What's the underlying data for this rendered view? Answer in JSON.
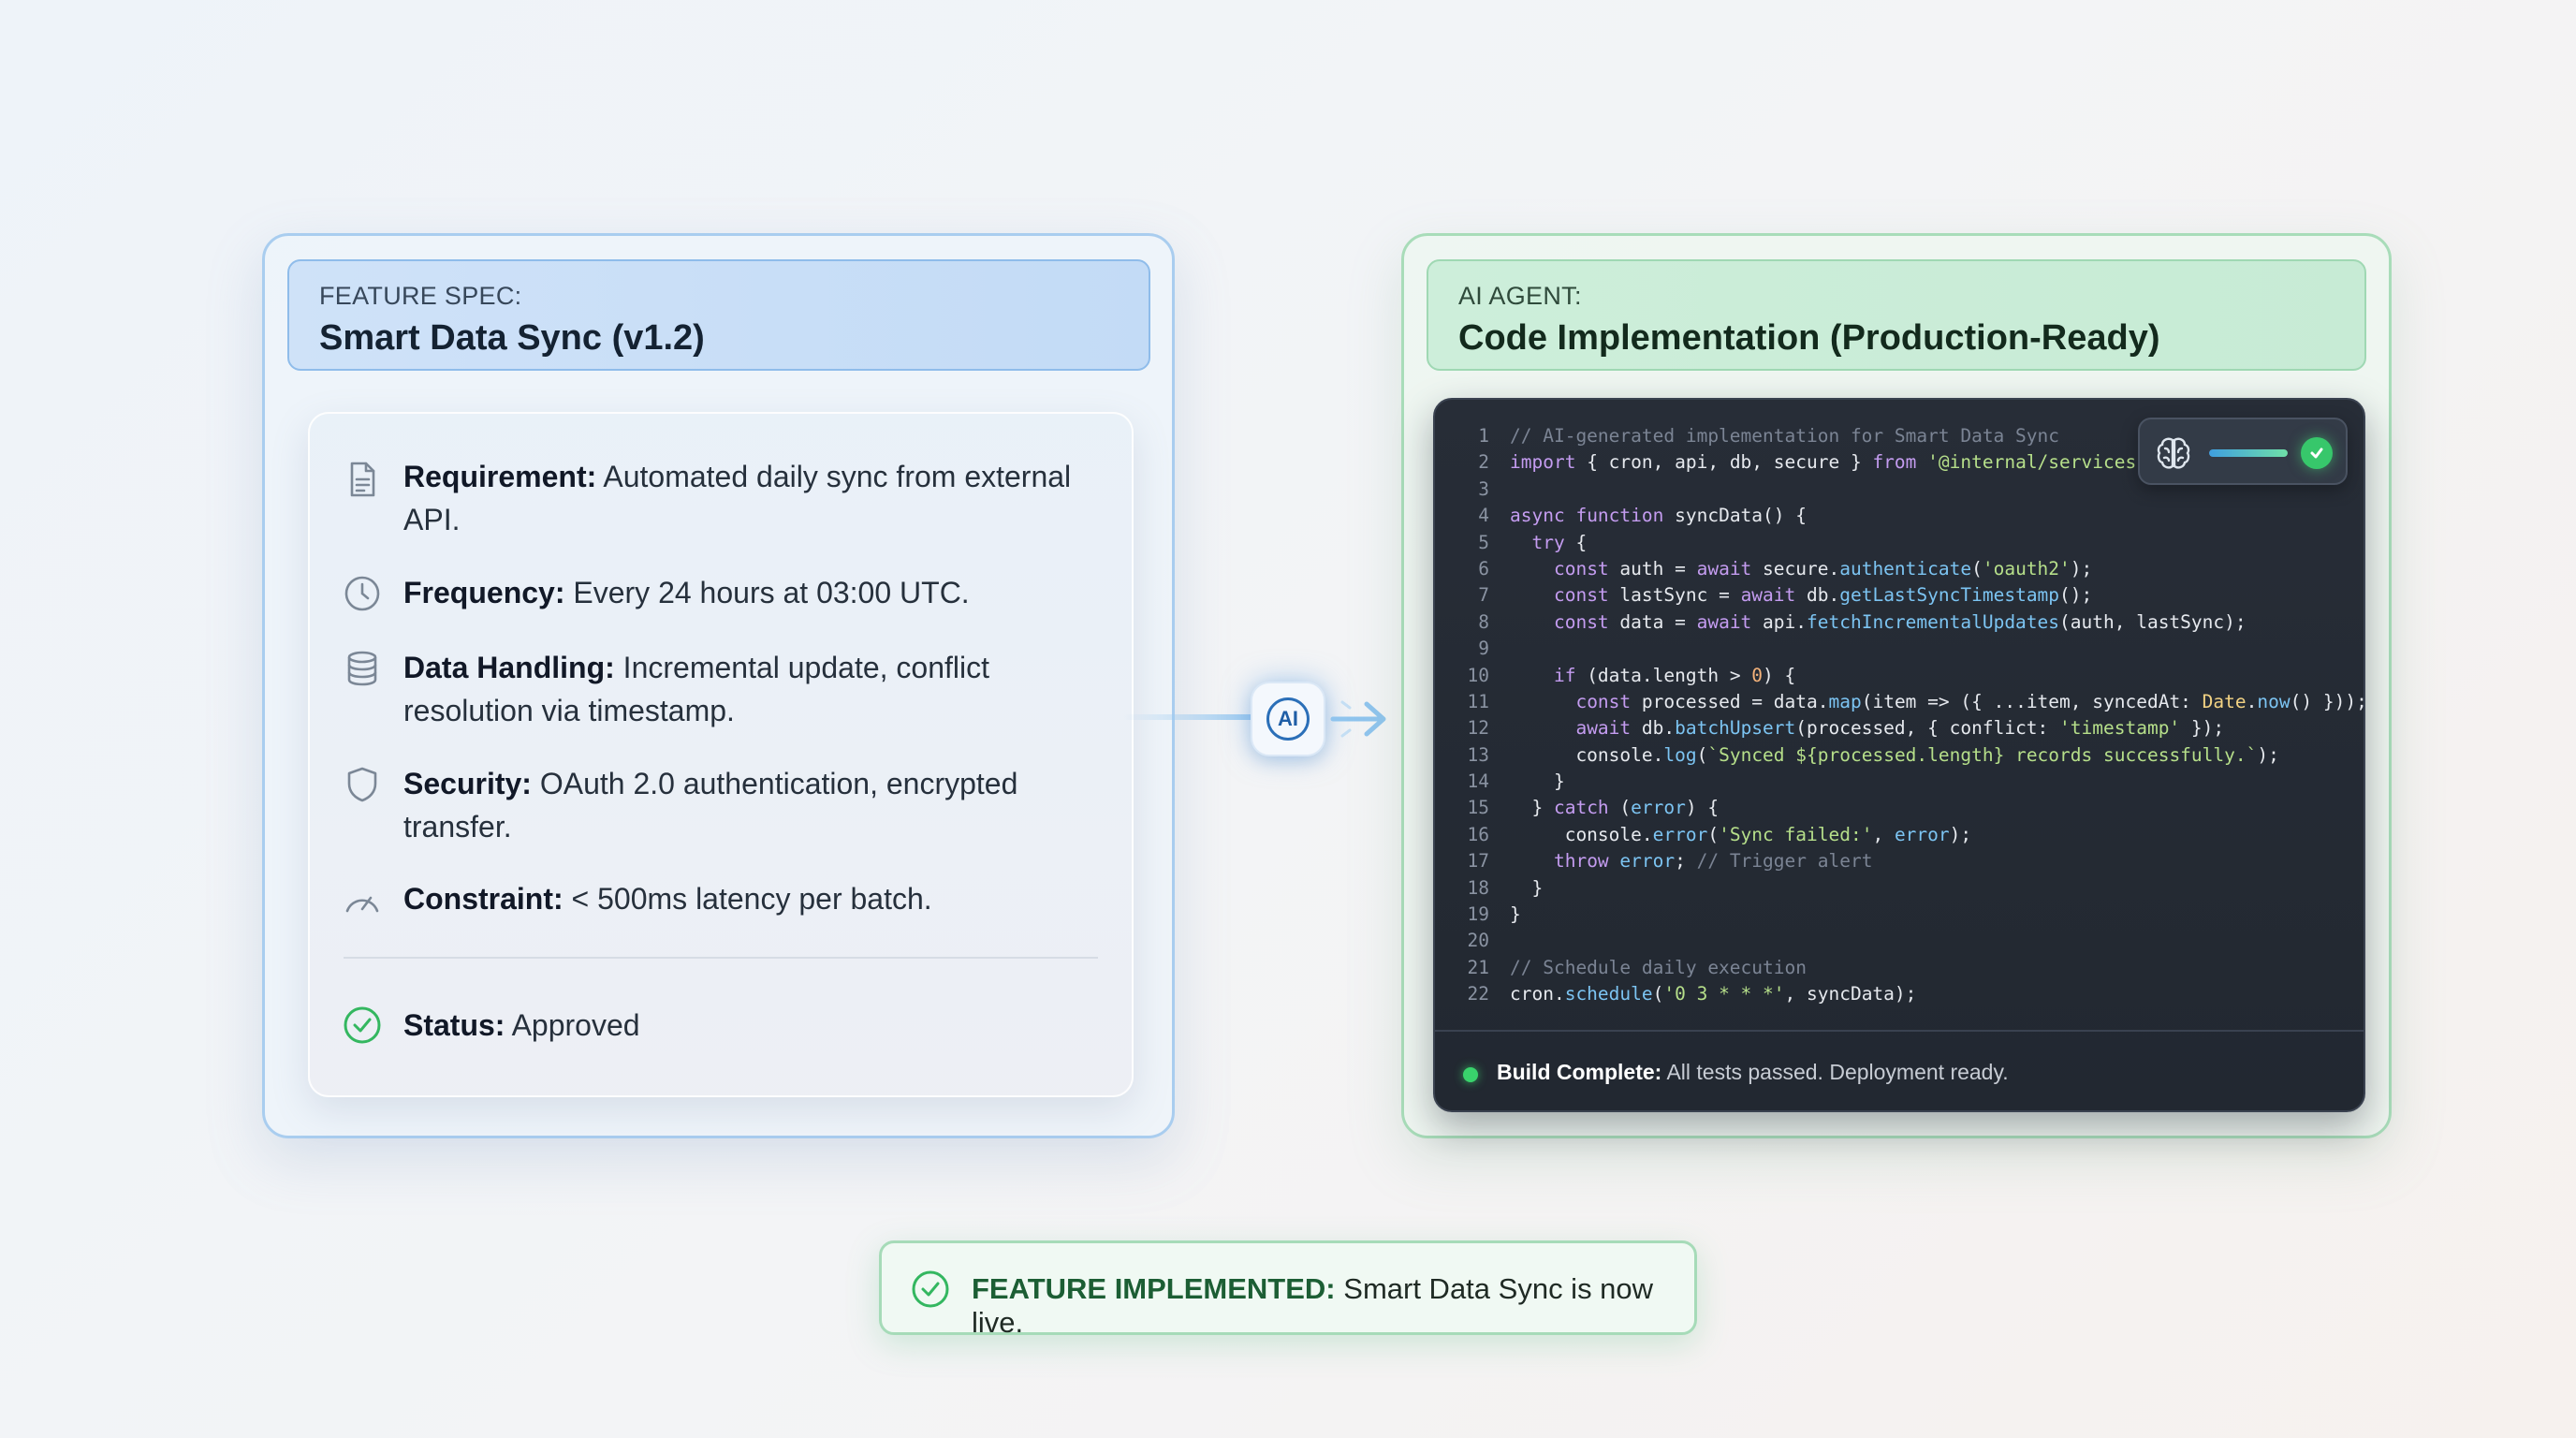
{
  "feature_spec": {
    "kicker": "FEATURE SPEC:",
    "title": "Smart Data Sync (v1.2)",
    "items": [
      {
        "icon": "document-icon",
        "label": "Requirement:",
        "value": "Automated daily sync from external API."
      },
      {
        "icon": "clock-icon",
        "label": "Frequency:",
        "value": "Every 24 hours at 03:00 UTC."
      },
      {
        "icon": "database-icon",
        "label": "Data Handling:",
        "value": "Incremental update, conflict resolution via timestamp."
      },
      {
        "icon": "shield-icon",
        "label": "Security:",
        "value": "OAuth 2.0 authentication, encrypted transfer."
      },
      {
        "icon": "gauge-icon",
        "label": "Constraint:",
        "value": "< 500ms latency per batch."
      }
    ],
    "status": {
      "icon": "check-circle-icon",
      "label": "Status:",
      "value": "Approved"
    }
  },
  "connector": {
    "badge_text": "AI"
  },
  "agent": {
    "kicker": "AI AGENT:",
    "title": "Code Implementation (Production-Ready)",
    "status_widget": {
      "icon": "brain-icon",
      "progress": 1.0,
      "check_icon": "check-icon"
    },
    "code_lines": [
      "1",
      "2",
      "3",
      "4",
      "5",
      "6",
      "7",
      "8",
      "9",
      "10",
      "11",
      "12",
      "13",
      "14",
      "15",
      "16",
      "17",
      "18",
      "19",
      "20",
      "21",
      "22"
    ],
    "code": [
      "// AI-generated implementation for Smart Data Sync",
      "import { cron, api, db, secure } from '@internal/services';",
      "",
      "async function syncData() {",
      "  try {",
      "    const auth = await secure.authenticate('oauth2');",
      "    const lastSync = await db.getLastSyncTimestamp();",
      "    const data = await api.fetchIncrementalUpdates(auth, lastSync);",
      "",
      "    if (data.length > 0) {",
      "      const processed = data.map(item => ({ ...item, syncedAt: Date.now() }));",
      "      await db.batchUpsert(processed, { conflict: 'timestamp' });",
      "      console.log(`Synced ${processed.length} records successfully.`);",
      "    }",
      "  } catch (error) {",
      "     console.error('Sync failed:', error);",
      "    throw error; // Trigger alert",
      "  }",
      "}",
      "",
      "// Schedule daily execution",
      "cron.schedule('0 3 * * *', syncData);"
    ],
    "footer": {
      "label": "Build Complete:",
      "value": "All tests passed. Deployment ready."
    }
  },
  "banner": {
    "icon": "check-circle-icon",
    "label": "FEATURE IMPLEMENTED:",
    "value": "Smart Data Sync is now live."
  },
  "colors": {
    "spec_accent": "#8fbcea",
    "agent_accent": "#9fd8b3",
    "code_bg": "#272d37",
    "success": "#37c76b"
  }
}
